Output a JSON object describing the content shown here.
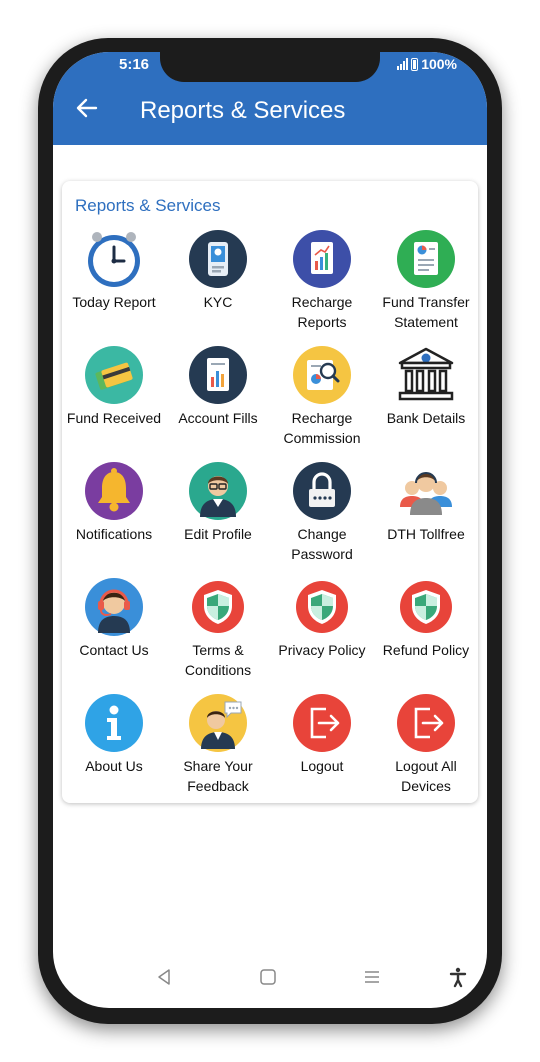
{
  "status_bar": {
    "time": "5:16",
    "battery": "100%"
  },
  "header": {
    "title": "Reports & Services"
  },
  "card": {
    "title": "Reports & Services"
  },
  "items": [
    {
      "label": "Today Report",
      "icon": "clock-icon"
    },
    {
      "label": "KYC",
      "icon": "id-badge-icon"
    },
    {
      "label": "Recharge Reports",
      "icon": "report-chart-icon"
    },
    {
      "label": "Fund Transfer Statement",
      "icon": "statement-icon"
    },
    {
      "label": "Fund Received",
      "icon": "cash-card-icon"
    },
    {
      "label": "Account Fills",
      "icon": "bar-chart-icon"
    },
    {
      "label": "Recharge Commission",
      "icon": "analytics-icon"
    },
    {
      "label": "Bank Details",
      "icon": "bank-icon"
    },
    {
      "label": "Notifications",
      "icon": "bell-icon"
    },
    {
      "label": "Edit Profile",
      "icon": "user-profile-icon"
    },
    {
      "label": "Change Password",
      "icon": "lock-icon"
    },
    {
      "label": "DTH Tollfree",
      "icon": "support-team-icon"
    },
    {
      "label": "Contact Us",
      "icon": "headset-icon"
    },
    {
      "label": "Terms & Conditions",
      "icon": "shield-icon"
    },
    {
      "label": "Privacy Policy",
      "icon": "shield-icon"
    },
    {
      "label": "Refund Policy",
      "icon": "shield-icon"
    },
    {
      "label": "About Us",
      "icon": "info-icon"
    },
    {
      "label": "Share Your Feedback",
      "icon": "feedback-icon"
    },
    {
      "label": "Logout",
      "icon": "logout-icon"
    },
    {
      "label": "Logout All Devices",
      "icon": "logout-icon"
    }
  ],
  "colors": {
    "header": "#2e6fbf",
    "accent": "#2e6fbf",
    "danger": "#e8443a"
  }
}
